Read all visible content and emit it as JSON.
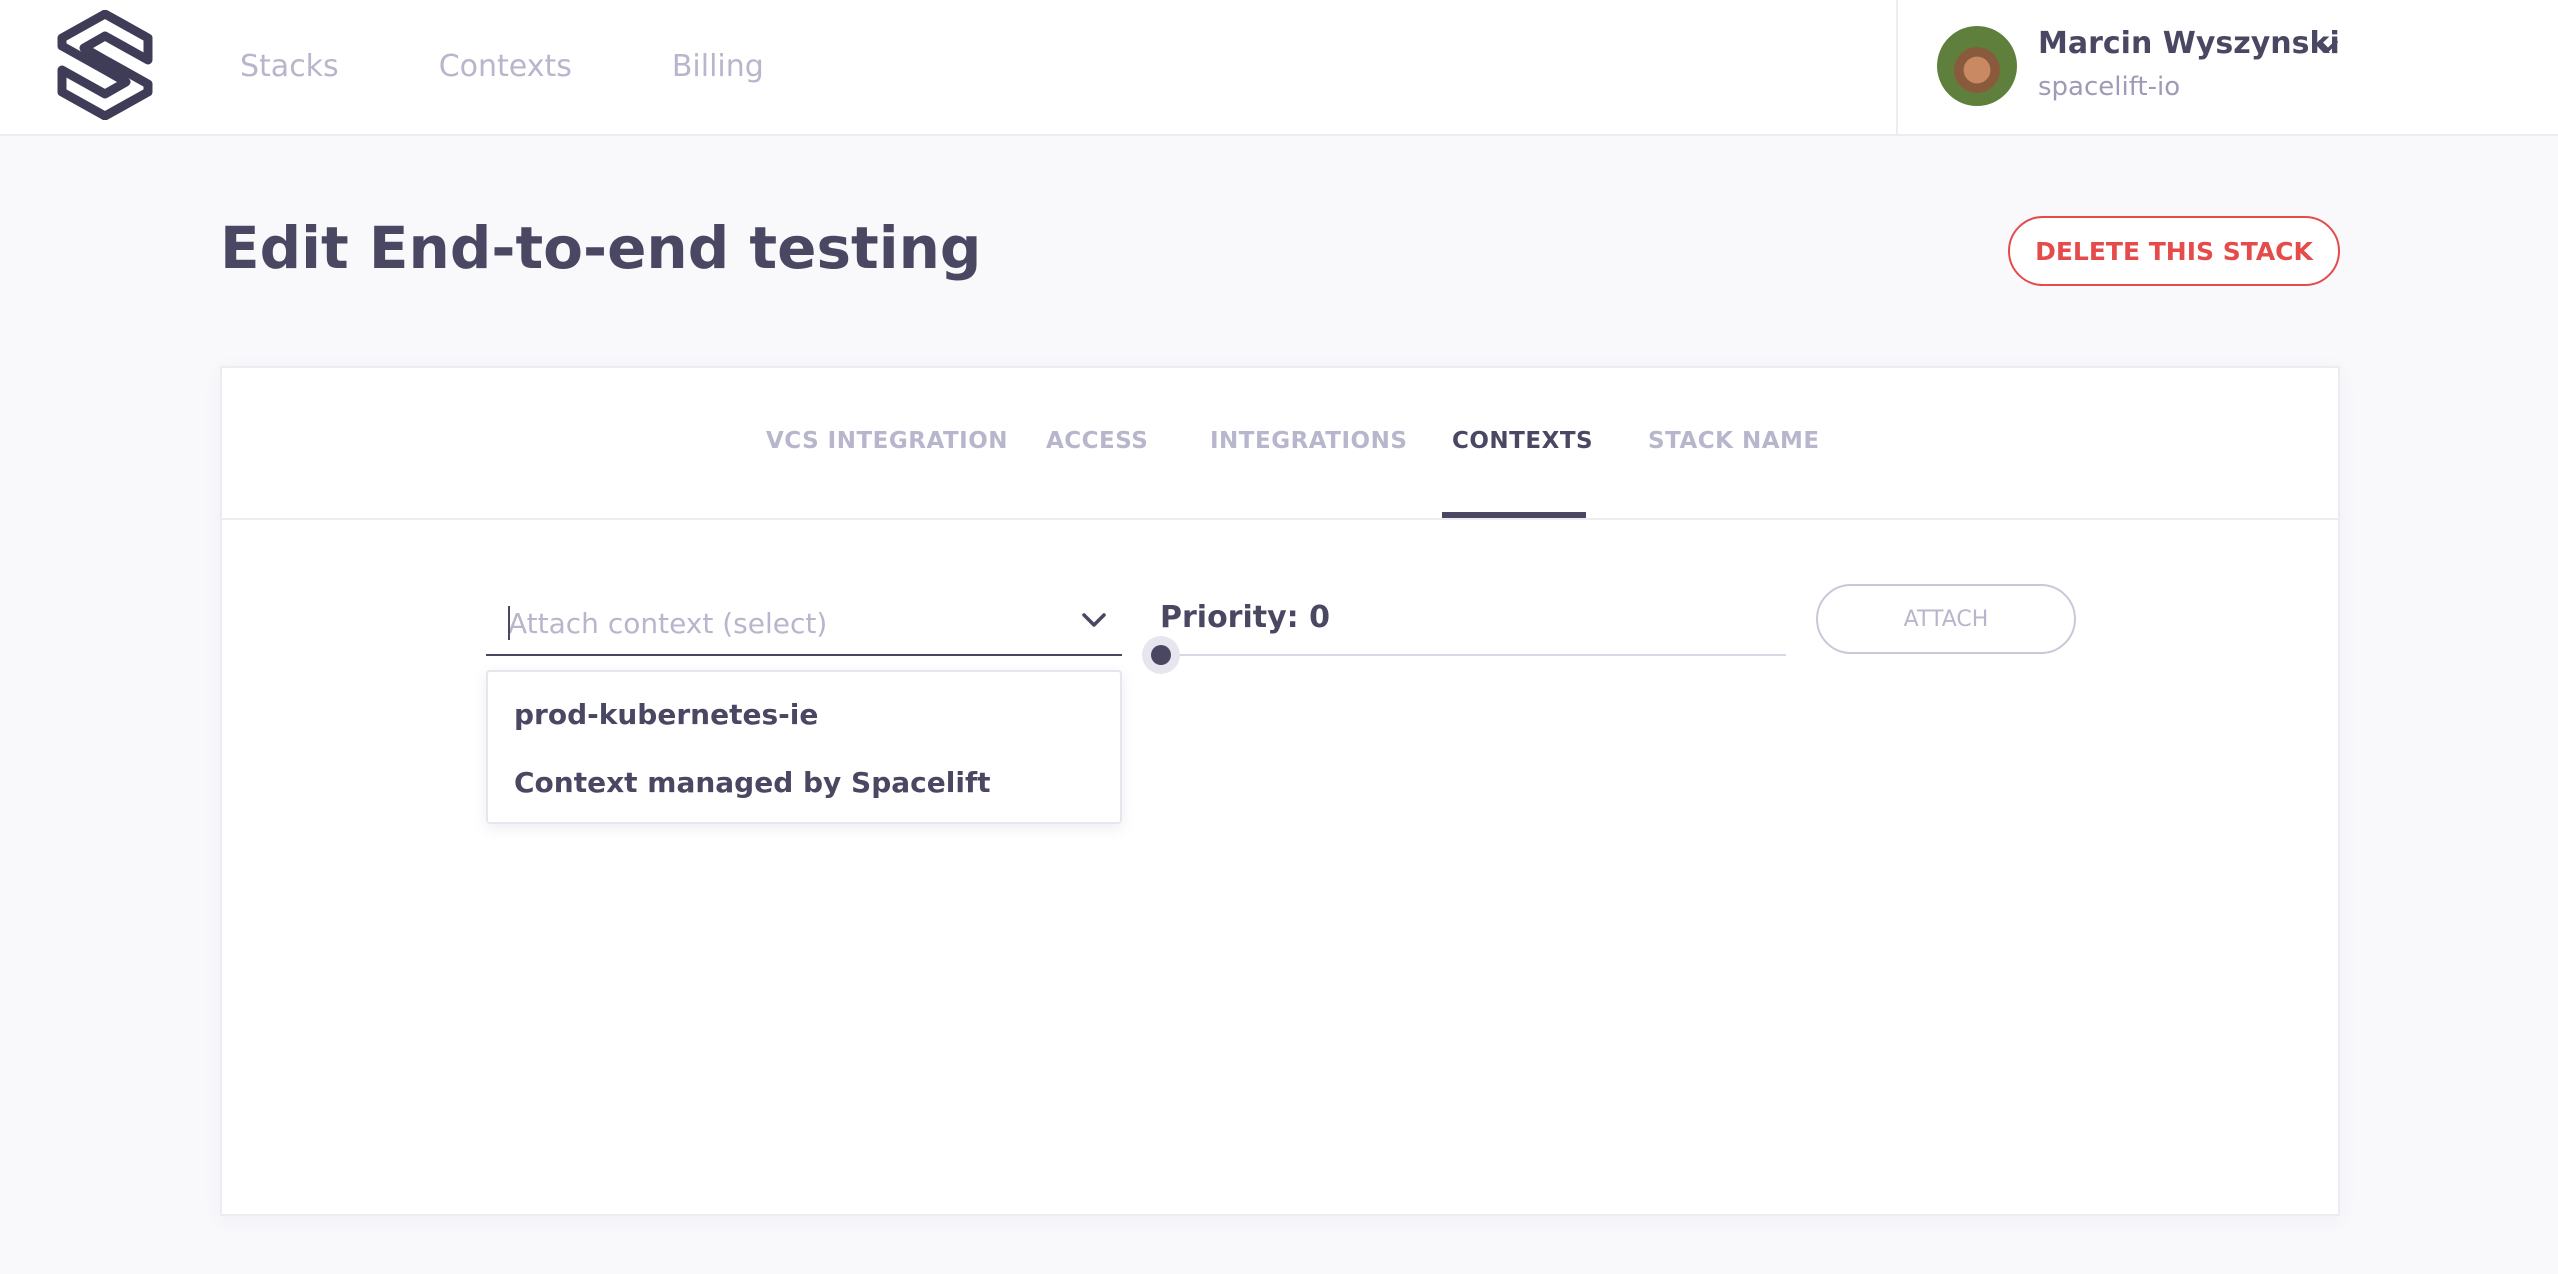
{
  "nav": {
    "items": [
      "Stacks",
      "Contexts",
      "Billing"
    ]
  },
  "user": {
    "name": "Marcin Wyszynski",
    "org": "spacelift-io"
  },
  "page": {
    "title": "Edit End-to-end testing",
    "delete_label": "DELETE THIS STACK"
  },
  "tabs": [
    {
      "label": "VCS INTEGRATION"
    },
    {
      "label": "ACCESS"
    },
    {
      "label": "INTEGRATIONS"
    },
    {
      "label": "CONTEXTS",
      "active": true
    },
    {
      "label": "STACK NAME"
    }
  ],
  "context_form": {
    "select_placeholder": "Attach context (select)",
    "options": [
      "prod-kubernetes-ie",
      "Context managed by Spacelift"
    ],
    "priority_label": "Priority: 0",
    "priority_value": 0,
    "attach_label": "ATTACH"
  },
  "colors": {
    "text_primary": "#4a4763",
    "text_muted": "#b7b6cc",
    "danger": "#e54b4b",
    "background": "#f9f9fc"
  },
  "icons": {
    "logo": "spacelift-logo",
    "user_menu": "chevron-down-icon",
    "select": "chevron-down-icon"
  }
}
